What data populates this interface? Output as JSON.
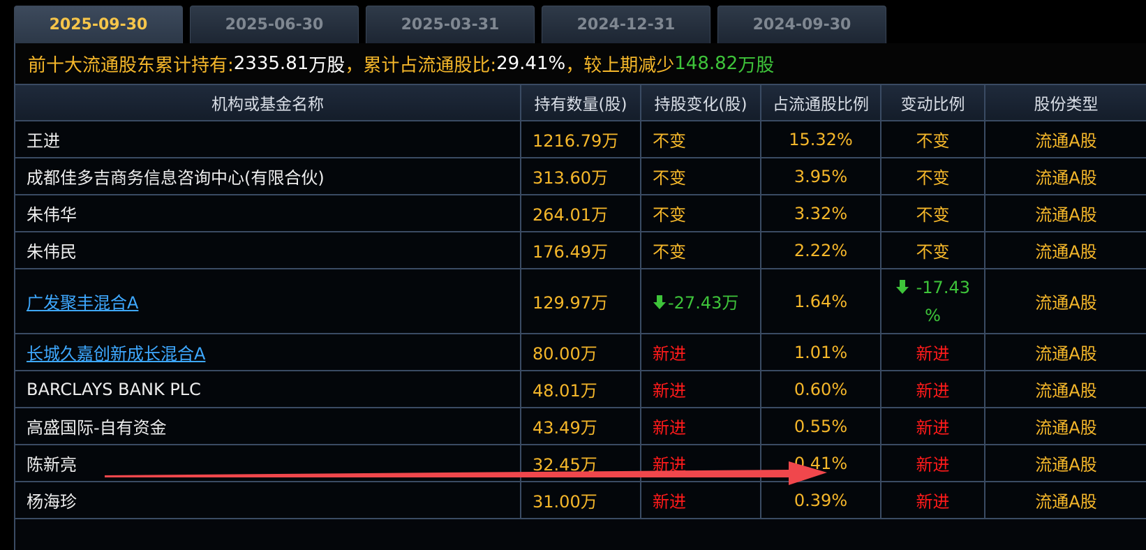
{
  "tabs": [
    {
      "label": "2025-09-30",
      "active": true
    },
    {
      "label": "2025-06-30",
      "active": false
    },
    {
      "label": "2025-03-31",
      "active": false
    },
    {
      "label": "2024-12-31",
      "active": false
    },
    {
      "label": "2024-09-30",
      "active": false
    }
  ],
  "summary": {
    "prefix": "前十大流通股东累计持有:",
    "total": "2335.81",
    "unit1": "万股",
    "ratio_label": "，累计占流通股比:",
    "ratio": "29.41%",
    "change_label": "，较上期减少",
    "change_value": "148.82",
    "change_unit": "万股"
  },
  "table": {
    "headers": [
      "机构或基金名称",
      "持有数量(股)",
      "持股变化(股)",
      "占流通股比例",
      "变动比例",
      "股份类型"
    ],
    "rows": [
      {
        "name": "王进",
        "link": false,
        "hold": "1216.79万",
        "change": "不变",
        "ratio": "15.32%",
        "vchg": "不变",
        "type": "流通A股"
      },
      {
        "name": "成都佳多吉商务信息咨询中心(有限合伙)",
        "link": false,
        "hold": "313.60万",
        "change": "不变",
        "ratio": "3.95%",
        "vchg": "不变",
        "type": "流通A股"
      },
      {
        "name": "朱伟华",
        "link": false,
        "hold": "264.01万",
        "change": "不变",
        "ratio": "3.32%",
        "vchg": "不变",
        "type": "流通A股"
      },
      {
        "name": "朱伟民",
        "link": false,
        "hold": "176.49万",
        "change": "不变",
        "ratio": "2.22%",
        "vchg": "不变",
        "type": "流通A股"
      },
      {
        "name": "广发聚丰混合A",
        "link": true,
        "hold": "129.97万",
        "change": "-27.43万",
        "ratio": "1.64%",
        "vchg_line1": "-17.43",
        "vchg_line2": "%",
        "type": "流通A股"
      },
      {
        "name": "长城久嘉创新成长混合A",
        "link": true,
        "hold": "80.00万",
        "change": "新进",
        "ratio": "1.01%",
        "vchg": "新进",
        "type": "流通A股"
      },
      {
        "name": "BARCLAYS BANK PLC",
        "link": false,
        "hold": "48.01万",
        "change": "新进",
        "ratio": "0.60%",
        "vchg": "新进",
        "type": "流通A股"
      },
      {
        "name": "高盛国际-自有资金",
        "link": false,
        "hold": "43.49万",
        "change": "新进",
        "ratio": "0.55%",
        "vchg": "新进",
        "type": "流通A股"
      },
      {
        "name": "陈新亮",
        "link": false,
        "hold": "32.45万",
        "change": "新进",
        "ratio": "0.41%",
        "vchg": "新进",
        "type": "流通A股"
      },
      {
        "name": "杨海珍",
        "link": false,
        "hold": "31.00万",
        "change": "新进",
        "ratio": "0.39%",
        "vchg": "新进",
        "type": "流通A股"
      }
    ]
  },
  "colors": {
    "accent_yellow": "#f5b72a",
    "increase_red": "#ff1a1a",
    "decrease_green": "#3ec43a",
    "link_blue": "#3ea8ff",
    "annotation_red": "#f0474c"
  }
}
